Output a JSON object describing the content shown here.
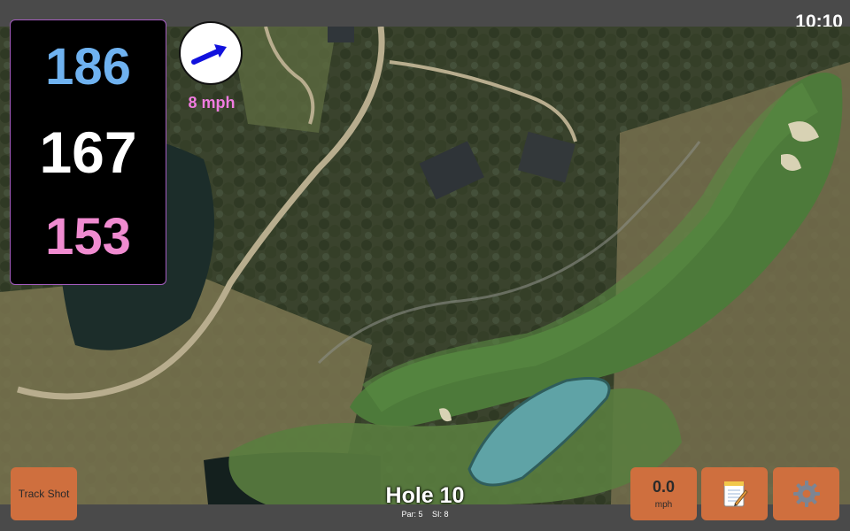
{
  "status": {
    "time": "10:10"
  },
  "distances": {
    "back": {
      "value": "167",
      "color": "#6fb2f0"
    },
    "center": {
      "value": "186",
      "color": "#ffffff"
    },
    "front": {
      "value": "153",
      "color": "#f08bd0"
    }
  },
  "wind": {
    "speed": "8 mph",
    "arrow_color": "#1111dd",
    "text_color": "#f07ce0",
    "direction_icon": "wind-arrow-icon"
  },
  "buttons": {
    "track_shot": "Track Shot",
    "speed_value": "0.0",
    "speed_unit": "mph",
    "notes_icon": "notepad-icon",
    "settings_icon": "gear-icon",
    "bg_color": "#cf6f3e"
  },
  "hole": {
    "title": "Hole 10",
    "par": "Par: 5",
    "si": "SI: 8"
  }
}
